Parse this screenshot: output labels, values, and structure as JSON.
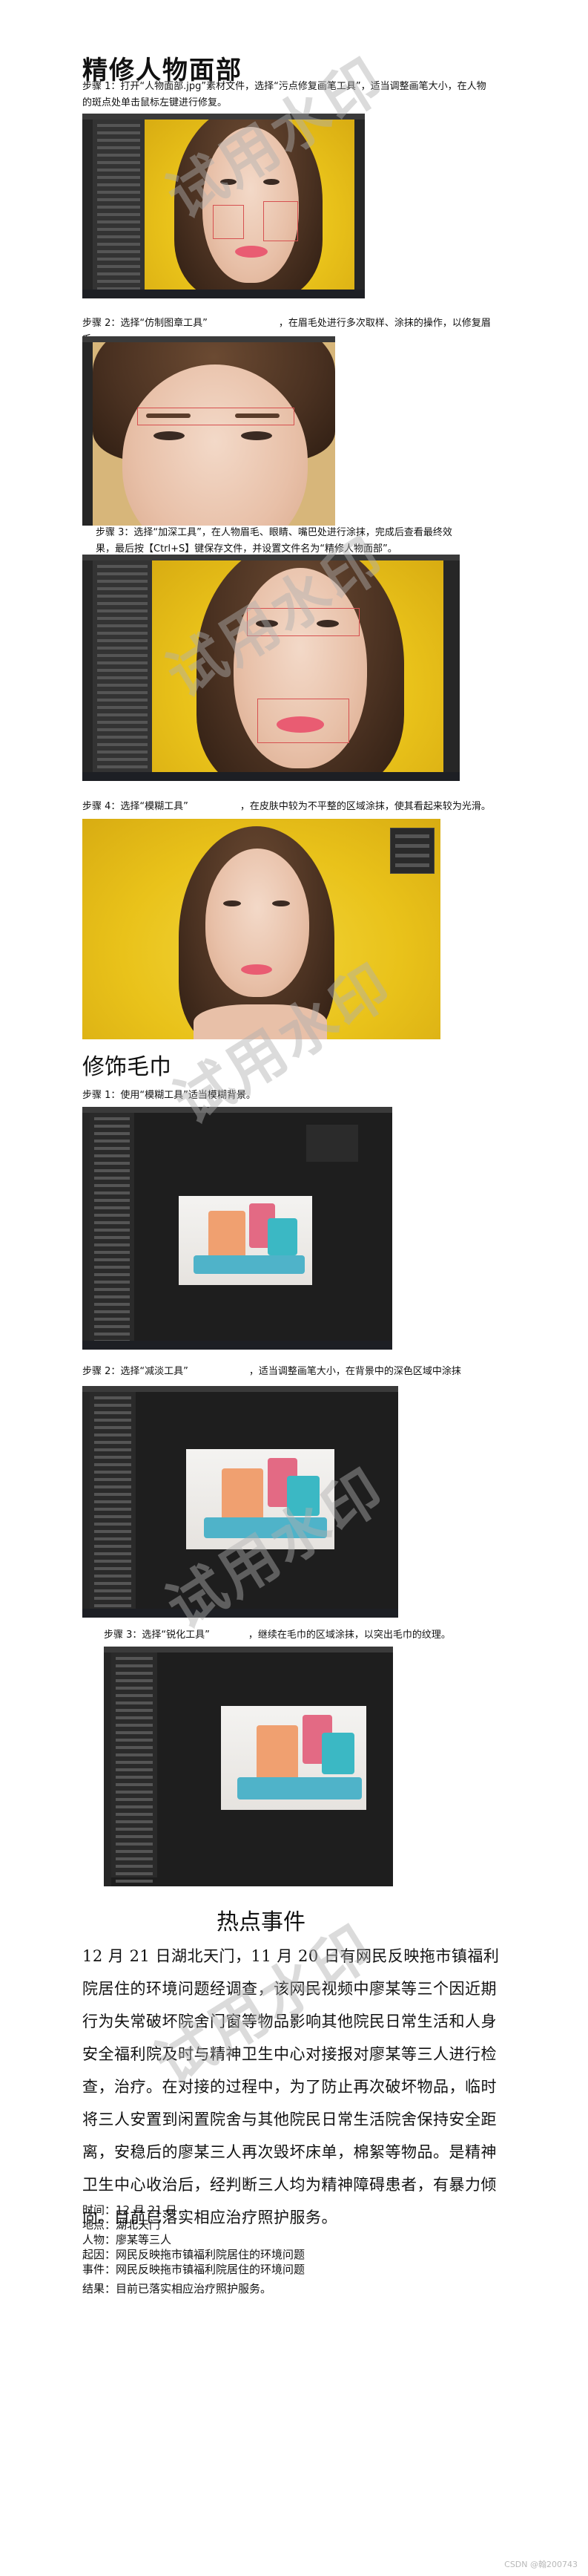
{
  "section1": {
    "title": "精修人物面部",
    "step1": "步骤 1：打开“人物面部.jpg”素材文件，选择“污点修复画笔工具”，适当调整画笔大小，在人物的斑点处单击鼠标左键进行修复。",
    "step2_a": "步骤 2：选择“仿制图章工具”",
    "step2_b": "，在眉毛处进行多次取样、涂抹的操作，以修复眉毛。",
    "step3": "步骤 3：选择“加深工具”，在人物眉毛、眼睛、嘴巴处进行涂抹，完成后查看最终效果，最后按【Ctrl+S】键保存文件，并设置文件名为“精修人物面部”。",
    "step4_a": "步骤 4：选择“模糊工具”",
    "step4_b": "，在皮肤中较为不平整的区域涂抹，使其看起来较为光滑。"
  },
  "section2": {
    "title": "修饰毛巾",
    "step1": "步骤 1：使用“模糊工具”适当模糊背景。",
    "step2_a": "步骤 2：选择“减淡工具”",
    "step2_b": "，适当调整画笔大小，在背景中的深色区域中涂抹",
    "step3_a": "步骤 3：选择“锐化工具”",
    "step3_b": "，继续在毛巾的区域涂抹，以突出毛巾的纹理。"
  },
  "watermark": "试用水印",
  "news": {
    "title": "热点事件",
    "paragraph": "12 月 21 日湖北天门，11 月 20 日有网民反映拖市镇福利院居住的环境问题经调查，该网民视频中廖某等三个因近期行为失常破坏院舍门窗等物品影响其他院民日常生活和人身安全福利院及时与精神卫生中心对接报对廖某等三人进行检查，治疗。在对接的过程中，为了防止再次破坏物品，临时将三人安置到闲置院舍与其他院民日常生活院舍保持安全距离，安稳后的廖某三人再次毁坏床单，棉絮等物品。是精神卫生中心收治后，经判断三人均为精神障碍患者，有暴力倾向。目前已落实相应治疗照护服务。",
    "meta": [
      "时间：12 月 21 日",
      "地点：湖北天门",
      "人物：廖某等三人",
      "起因：网民反映拖市镇福利院居住的环境问题",
      "事件：网民反映拖市镇福利院居住的环境问题",
      "结果：目前已落实相应治疗照护服务。"
    ]
  },
  "footer_stamp": "CSDN @翰200743"
}
